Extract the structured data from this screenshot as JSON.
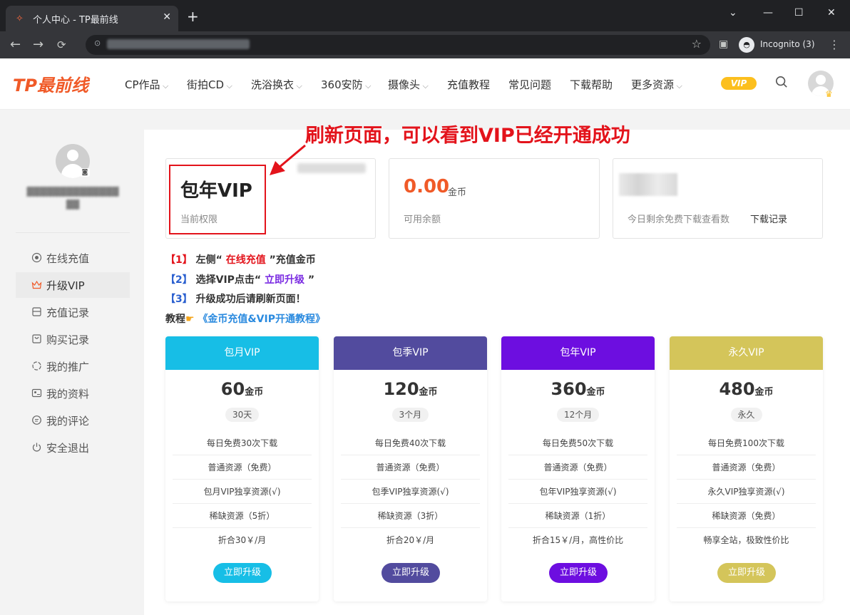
{
  "browser": {
    "tab_title": "个人中心 - TP最前线",
    "incognito_label": "Incognito (3)"
  },
  "header": {
    "logo": "TP最前线",
    "nav": [
      "CP作品",
      "街拍CD",
      "洗浴换衣",
      "360安防",
      "摄像头",
      "充值教程",
      "常见问题",
      "下载帮助",
      "更多资源"
    ],
    "nav_dropdown": [
      true,
      true,
      true,
      true,
      true,
      false,
      false,
      false,
      true
    ],
    "vip_badge": "VIP",
    "accent_color": "#f05a28"
  },
  "annotation": "刷新页面，可以看到VIP已经开通成功",
  "sidebar": {
    "items": [
      {
        "label": "在线充值",
        "icon": "circle-coin-icon"
      },
      {
        "label": "升级VIP",
        "icon": "crown-icon",
        "active": true
      },
      {
        "label": "充值记录",
        "icon": "receipt-icon"
      },
      {
        "label": "购买记录",
        "icon": "bag-icon"
      },
      {
        "label": "我的推广",
        "icon": "share-icon"
      },
      {
        "label": "我的资料",
        "icon": "profile-card-icon"
      },
      {
        "label": "我的评论",
        "icon": "comment-icon"
      },
      {
        "label": "安全退出",
        "icon": "power-icon"
      }
    ]
  },
  "stats": {
    "vip_level": "包年VIP",
    "vip_level_label": "当前权限",
    "balance": "0.00",
    "balance_unit": "金币",
    "balance_label": "可用余额",
    "free_downloads_label": "今日剩余免费下载查看数",
    "download_records": "下载记录"
  },
  "steps": {
    "s1_num": "【1】",
    "s1_a": "左侧“",
    "s1_link": "在线充值",
    "s1_b": "”充值金币",
    "s2_num": "【2】",
    "s2_a": "选择VIP点击“",
    "s2_link": "立即升级",
    "s2_b": "”",
    "s3_num": "【3】",
    "s3_a": "升级成功后请刷新页面！",
    "tut_label": "教程",
    "tut_link": "《金币充值&VIP开通教程》"
  },
  "plans": [
    {
      "name": "包月VIP",
      "price": "60",
      "unit": "金币",
      "duration": "30天",
      "color": "#17bee6",
      "features": [
        "每日免费30次下载",
        "普通资源（免费）",
        "包月VIP独享资源(√)",
        "稀缺资源（5折）",
        "折合30￥/月"
      ],
      "button": "立即升级"
    },
    {
      "name": "包季VIP",
      "price": "120",
      "unit": "金币",
      "duration": "3个月",
      "color": "#524b9e",
      "features": [
        "每日免费40次下载",
        "普通资源（免费）",
        "包季VIP独享资源(√)",
        "稀缺资源（3折）",
        "折合20￥/月"
      ],
      "button": "立即升级"
    },
    {
      "name": "包年VIP",
      "price": "360",
      "unit": "金币",
      "duration": "12个月",
      "color": "#6d0ee0",
      "features": [
        "每日免费50次下载",
        "普通资源（免费）",
        "包年VIP独享资源(√)",
        "稀缺资源（1折）",
        "折合15￥/月，高性价比"
      ],
      "button": "立即升级"
    },
    {
      "name": "永久VIP",
      "price": "480",
      "unit": "金币",
      "duration": "永久",
      "color": "#d4c55a",
      "features": [
        "每日免费100次下载",
        "普通资源（免费）",
        "永久VIP独享资源(√)",
        "稀缺资源（免费）",
        "畅享全站，极致性价比"
      ],
      "button": "立即升级"
    }
  ]
}
